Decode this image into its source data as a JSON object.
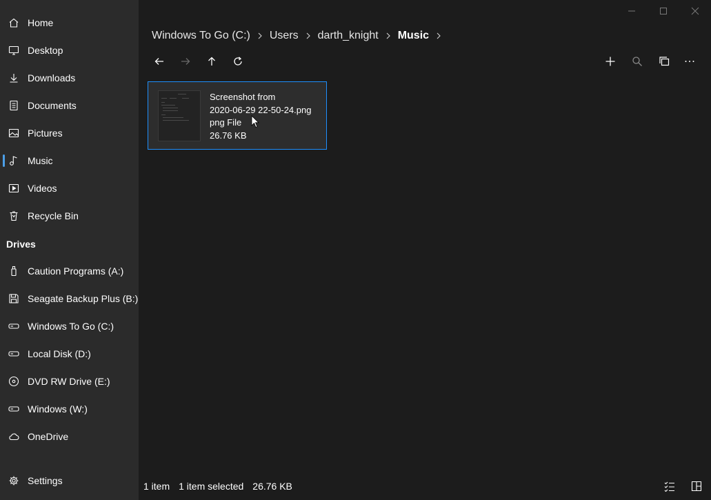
{
  "sidebar": {
    "items": [
      {
        "label": "Home",
        "icon": "home-icon"
      },
      {
        "label": "Desktop",
        "icon": "desktop-icon"
      },
      {
        "label": "Downloads",
        "icon": "download-icon"
      },
      {
        "label": "Documents",
        "icon": "document-icon"
      },
      {
        "label": "Pictures",
        "icon": "picture-icon"
      },
      {
        "label": "Music",
        "icon": "music-icon",
        "selected": true
      },
      {
        "label": "Videos",
        "icon": "video-icon"
      },
      {
        "label": "Recycle Bin",
        "icon": "recycle-bin-icon"
      }
    ],
    "drives_header": "Drives",
    "drives": [
      {
        "label": "Caution Programs (A:)",
        "icon": "usb-drive-icon"
      },
      {
        "label": "Seagate Backup Plus (B:)",
        "icon": "save-drive-icon"
      },
      {
        "label": "Windows To Go (C:)",
        "icon": "hard-drive-icon"
      },
      {
        "label": "Local Disk (D:)",
        "icon": "hard-drive-icon"
      },
      {
        "label": "DVD RW Drive (E:)",
        "icon": "disc-drive-icon"
      },
      {
        "label": "Windows (W:)",
        "icon": "hard-drive-icon"
      },
      {
        "label": "OneDrive",
        "icon": "cloud-icon"
      }
    ],
    "settings_label": "Settings"
  },
  "breadcrumb": {
    "items": [
      "Windows To Go (C:)",
      "Users",
      "darth_knight",
      "Music"
    ]
  },
  "file": {
    "name_line1": "Screenshot from",
    "name_line2": "2020-06-29 22-50-24.png",
    "type": "png File",
    "size": "26.76 KB"
  },
  "status": {
    "item_count": "1 item",
    "selected": "1 item selected",
    "size": "26.76 KB"
  },
  "colors": {
    "accent": "#4c9fe8",
    "selection_border": "#1e90ff",
    "sidebar_bg": "#2b2b2b",
    "content_bg": "#1c1c1c"
  }
}
